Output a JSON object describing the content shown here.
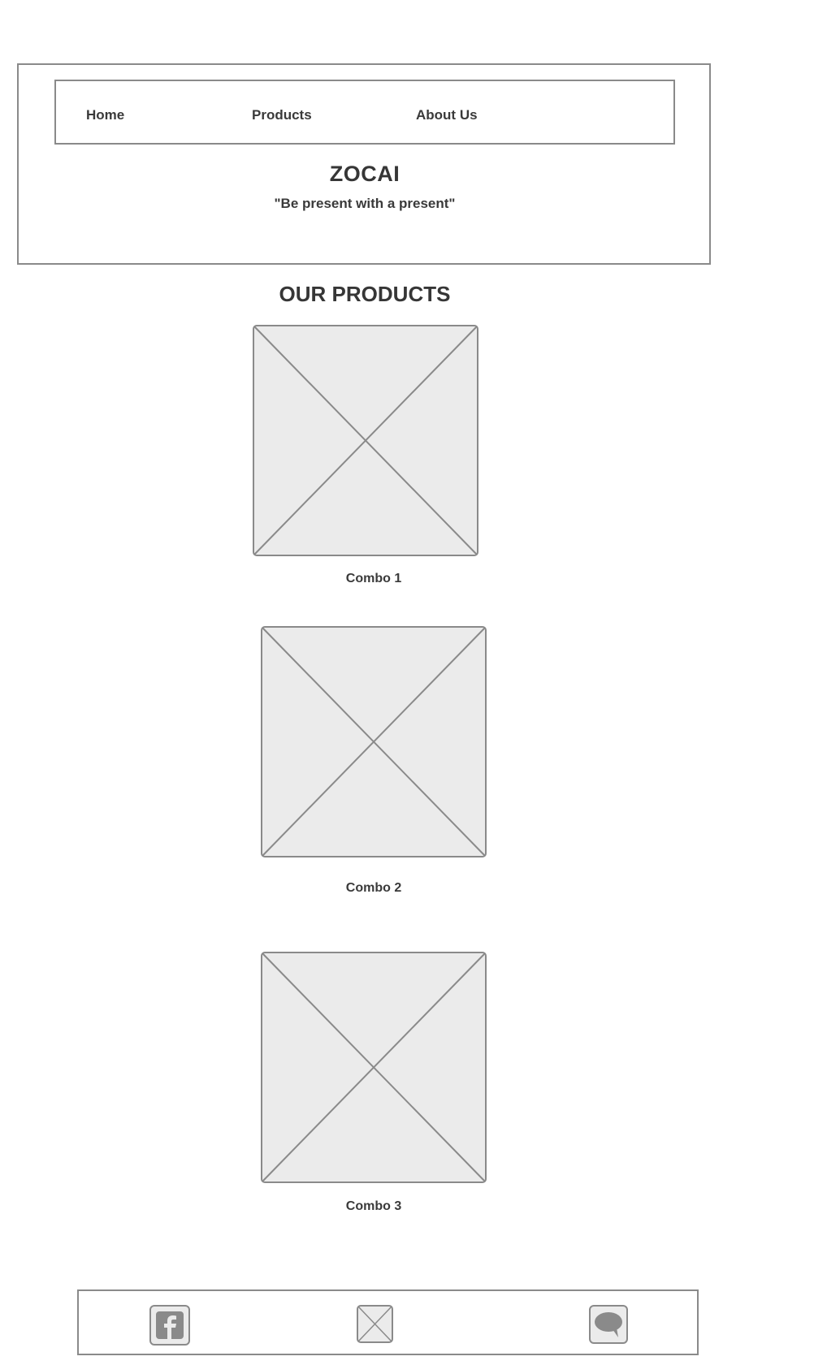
{
  "header": {
    "nav": {
      "items": [
        {
          "label": "Home"
        },
        {
          "label": "Products"
        },
        {
          "label": "About Us"
        }
      ]
    },
    "brand": "ZOCAI",
    "tagline": "\"Be present with a present\""
  },
  "products": {
    "title": "OUR PRODUCTS",
    "items": [
      {
        "label": "Combo 1"
      },
      {
        "label": "Combo 2"
      },
      {
        "label": "Combo 3"
      }
    ]
  },
  "footer": {
    "social": [
      {
        "icon": "facebook-icon"
      },
      {
        "icon": "image-placeholder-icon"
      },
      {
        "icon": "chat-bubble-icon"
      }
    ]
  },
  "colors": {
    "border": "#8a8a8a",
    "placeholder_fill": "#ebebeb",
    "text": "#333333"
  }
}
